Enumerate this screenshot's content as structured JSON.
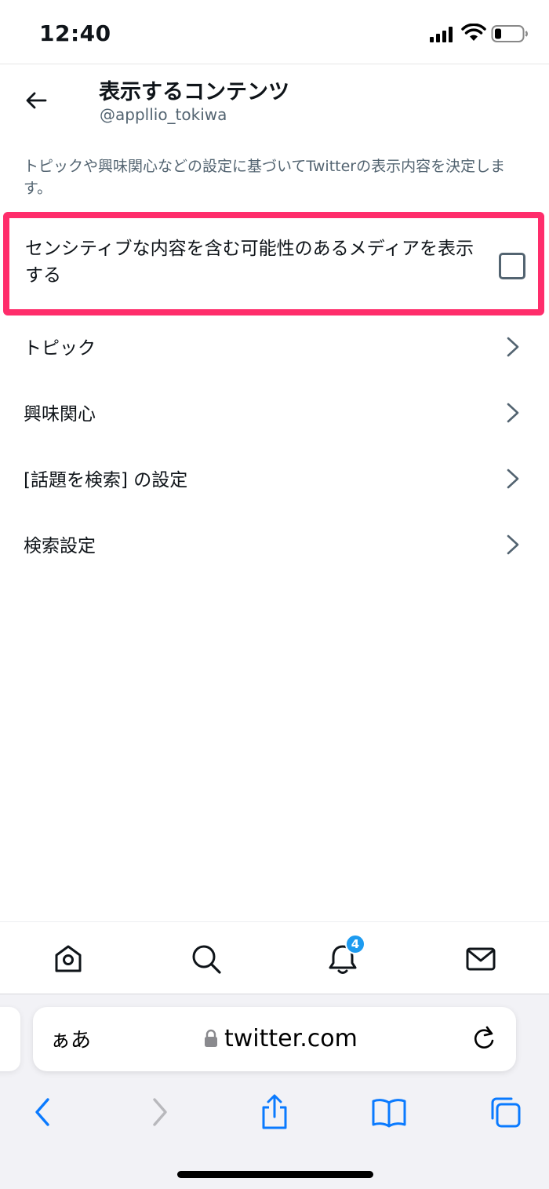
{
  "status_bar": {
    "time": "12:40"
  },
  "header": {
    "title": "表示するコンテンツ",
    "subtitle": "@appllio_tokiwa"
  },
  "description": "トピックや興味関心などの設定に基づいてTwitterの表示内容を決定します。",
  "sensitive_media": {
    "label": "センシティブな内容を含む可能性のあるメディアを表示する",
    "checked": false,
    "highlight_color": "#ff2d6b"
  },
  "menu_items": [
    {
      "label": "トピック"
    },
    {
      "label": "興味関心"
    },
    {
      "label": "[話題を検索] の設定"
    },
    {
      "label": "検索設定"
    }
  ],
  "bottom_nav": {
    "items": [
      "home-icon",
      "search-icon",
      "notifications-icon",
      "messages-icon"
    ],
    "notification_badge": "4"
  },
  "browser": {
    "aa": "ぁあ",
    "url": "twitter.com",
    "accent": "#0a7aff"
  }
}
